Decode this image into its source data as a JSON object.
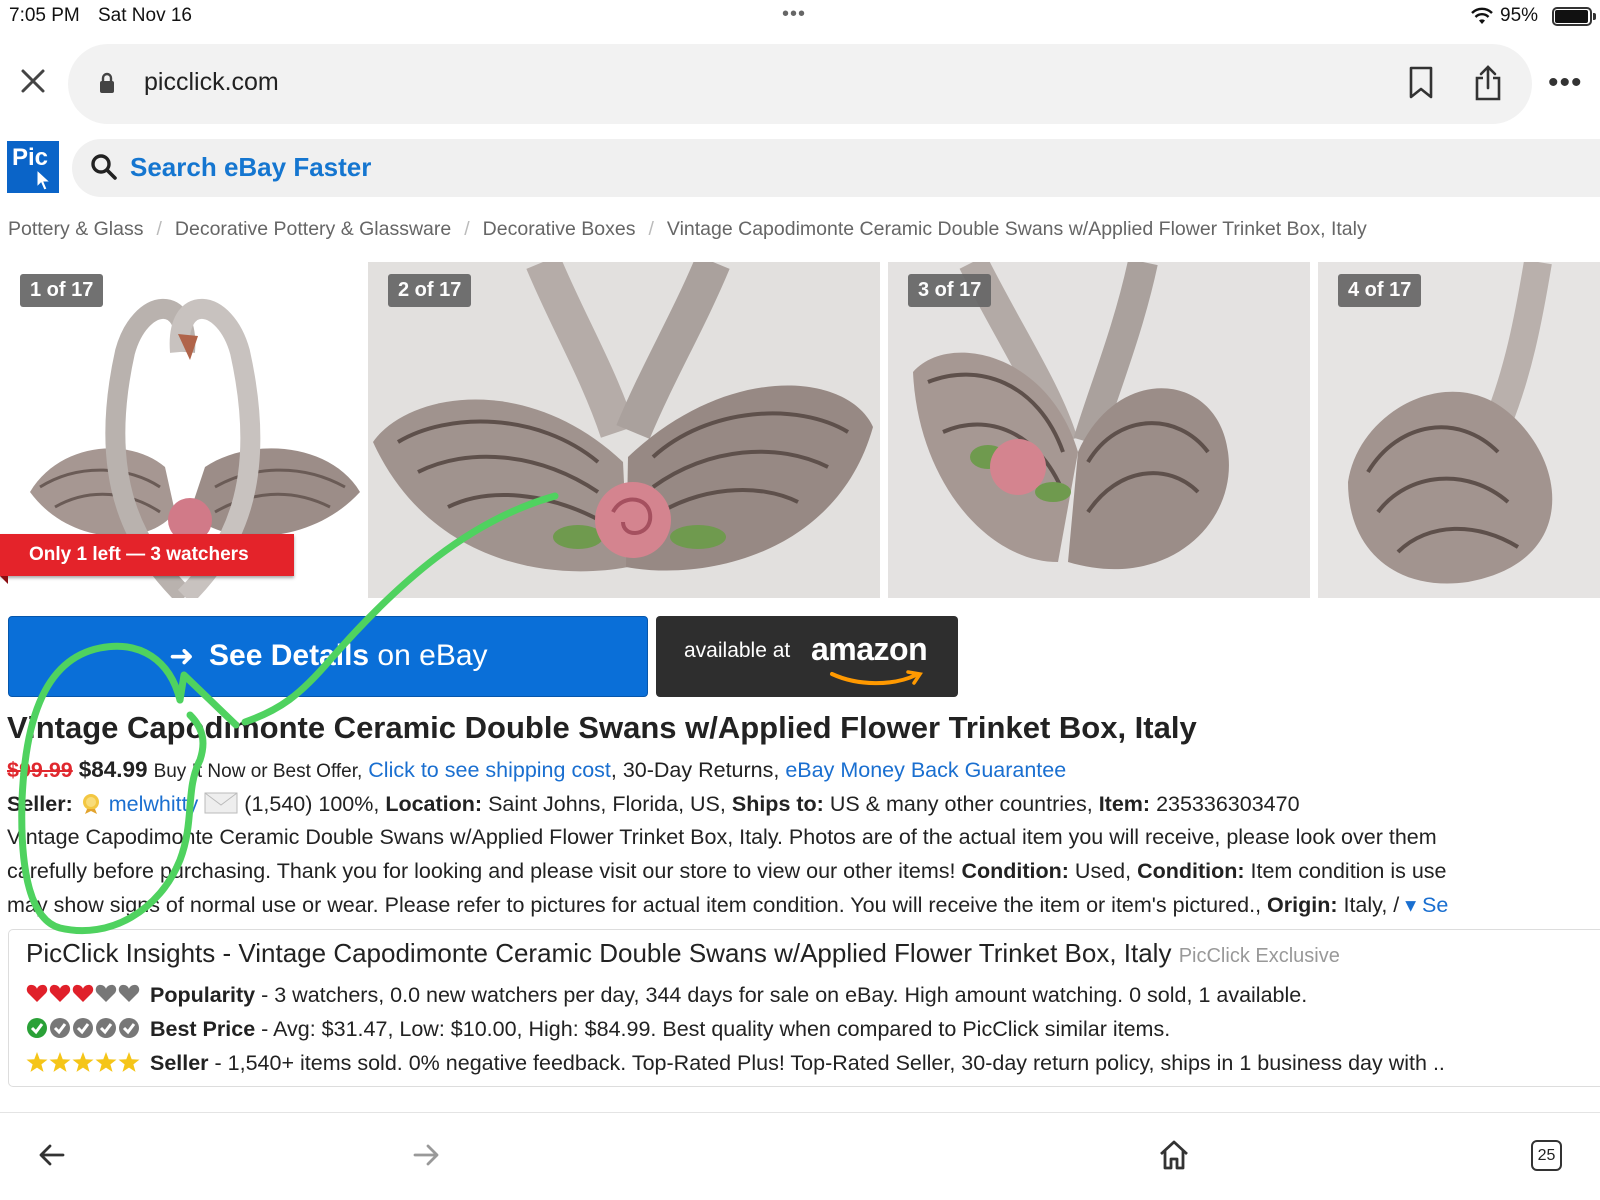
{
  "status_bar": {
    "time": "7:05 PM",
    "date": "Sat Nov 16",
    "battery": "95%"
  },
  "browser": {
    "url": "picclick.com",
    "tab_count": "25"
  },
  "header": {
    "logo_text": "Pic",
    "search_placeholder": "Search eBay Faster"
  },
  "breadcrumb": [
    "Pottery & Glass",
    "Decorative Pottery & Glassware",
    "Decorative Boxes",
    "Vintage Capodimonte Ceramic Double Swans w/Applied Flower Trinket Box, Italy"
  ],
  "gallery": {
    "badges": [
      "1 of 17",
      "2 of 17",
      "3 of 17",
      "4 of 17"
    ],
    "ribbon": "Only 1 left — 3 watchers"
  },
  "buttons": {
    "ebay_bold": "See Details",
    "ebay_rest": " on eBay",
    "amazon_pre": "available at",
    "amazon_brand": "amazon"
  },
  "listing": {
    "title": "Vintage Capodimonte Ceramic Double Swans w/Applied Flower Trinket Box, Italy",
    "old_price": "$99.99",
    "price": "$84.99",
    "buy_options": "Buy It Now or Best Offer,",
    "shipping_link": "Click to see shipping cost",
    "returns": ", 30-Day Returns, ",
    "guarantee_link": "eBay Money Back Guarantee",
    "seller_label": "Seller:",
    "seller_name": "melwhitty",
    "seller_stats": "(1,540) 100%,",
    "location_label": "Location:",
    "location": "Saint Johns, Florida, US,",
    "ships_label": "Ships to:",
    "ships": "US & many other countries,",
    "item_label": "Item:",
    "item_number": "235336303470",
    "desc_1": "Vintage Capodimonte Ceramic Double Swans w/Applied Flower Trinket Box, Italy. Photos are of the actual item you will receive, please look over them",
    "desc_2a": "carefully before purchasing. Thank you for looking and please visit our store to view our other items! ",
    "condition_label": "Condition:",
    "condition_1": " Used, ",
    "condition_2": " Item condition is use",
    "desc_3": "may show signs of normal use or wear. Please refer to pictures for actual item condition. You will receive the item or item's pictured., ",
    "origin_label": "Origin:",
    "origin": " Italy, /",
    "see_more": "Se"
  },
  "insights": {
    "title": "PicClick Insights - Vintage Capodimonte Ceramic Double Swans w/Applied Flower Trinket Box, Italy",
    "exclusive": "PicClick Exclusive",
    "popularity_label": "Popularity",
    "popularity_text": " - 3 watchers, 0.0 new watchers per day, 344 days for sale on eBay. High amount watching. 0 sold, 1 available.",
    "popularity_hearts": 3,
    "price_label": "Best Price",
    "price_text": " - Avg: $31.47, Low: $10.00, High: $84.99. Best quality when compared to PicClick similar items.",
    "price_checks": 1,
    "seller_label": "Seller",
    "seller_text": " - 1,540+ items sold. 0% negative feedback. Top-Rated Plus! Top-Rated Seller, 30-day return policy, ships in 1 business day with ..",
    "seller_stars": 5
  },
  "colors": {
    "picclick_blue": "#0a64c8",
    "ebay_button": "#0a6fd8",
    "link": "#1a6fd0",
    "ribbon_red": "#e4232a",
    "annotation_green": "#4fd25f"
  }
}
